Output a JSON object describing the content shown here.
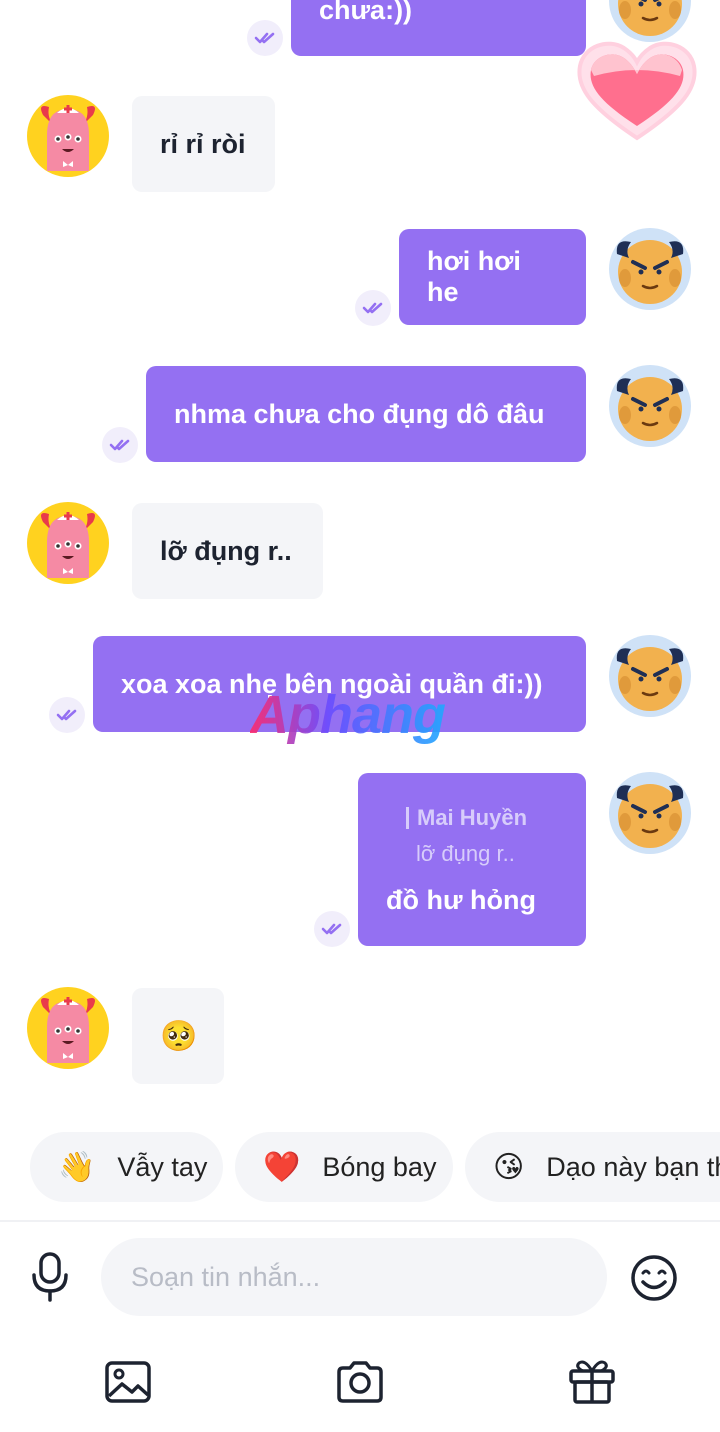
{
  "messages": [
    {
      "id": "m0",
      "dir": "out",
      "text": "ở dưới ướt chưa:))"
    },
    {
      "id": "m1",
      "dir": "in",
      "text": "rỉ rỉ ròi"
    },
    {
      "id": "m2",
      "dir": "out",
      "text": "hơi hơi he"
    },
    {
      "id": "m3",
      "dir": "out",
      "text": "nhma chưa cho đụng dô đâu"
    },
    {
      "id": "m4",
      "dir": "in",
      "text": "lỡ đụng r.."
    },
    {
      "id": "m5",
      "dir": "out",
      "text": "xoa xoa nhẹ bên ngoài quần đi:))"
    },
    {
      "id": "m6",
      "dir": "out",
      "reply_to_name": "Mai Huyền",
      "reply_to_text": "lỡ đụng r..",
      "text": "đồ hư hỏng"
    },
    {
      "id": "m7",
      "dir": "in",
      "text": "🥺"
    }
  ],
  "watermark": "Aphang",
  "quick_replies": [
    {
      "emoji": "👋",
      "label": "Vẫy tay"
    },
    {
      "emoji": "❤️",
      "label": "Bóng bay"
    },
    {
      "emoji": "😘",
      "label": "Dạo này bạn th"
    }
  ],
  "composer": {
    "placeholder": "Soạn tin nhắn..."
  },
  "icons": {
    "mic": "microphone-icon",
    "emoji": "emoji-icon",
    "gallery": "image-icon",
    "camera": "camera-icon",
    "gift": "gift-icon",
    "read": "double-check-icon"
  },
  "colors": {
    "outgoing": "#9470f2",
    "incoming": "#f4f5f8",
    "text_dark": "#1d2330"
  }
}
